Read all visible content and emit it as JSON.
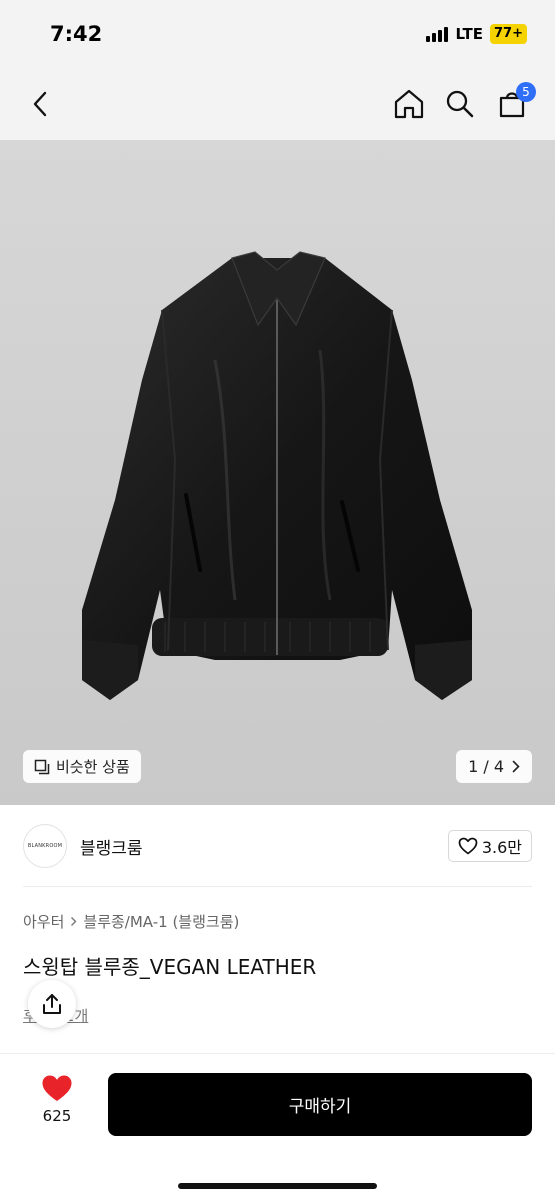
{
  "status_bar": {
    "time": "7:42",
    "network": "LTE",
    "battery": "77+"
  },
  "nav": {
    "cart_count": "5"
  },
  "hero": {
    "similar_label": "비슷한 상품",
    "pager": "1 / 4"
  },
  "brand": {
    "logo_text": "BLANKROOM",
    "name": "블랭크룸",
    "likes": "3.6만"
  },
  "product": {
    "breadcrumb": [
      "아우터",
      "블루종/MA-1 (블랭크룸)"
    ],
    "title": "스윙탑 블루종_VEGAN LEATHER",
    "review_text": "후기 42개"
  },
  "bottom": {
    "like_count": "625",
    "buy_label": "구매하기"
  },
  "colors": {
    "accent_badge": "#2f6ef6",
    "heart": "#e8242a",
    "battery": "#f5d300"
  },
  "icons": [
    "back-icon",
    "home-icon",
    "search-icon",
    "cart-icon",
    "similar-icon",
    "chevron-right-icon",
    "heart-outline-icon",
    "share-icon",
    "heart-filled-icon"
  ]
}
